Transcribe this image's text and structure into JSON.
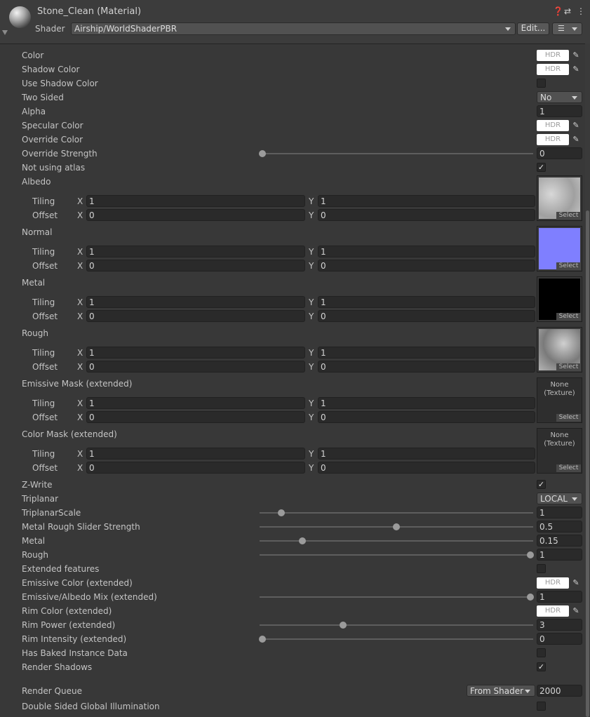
{
  "header": {
    "title": "Stone_Clean (Material)",
    "shader_label": "Shader",
    "shader_value": "Airship/WorldShaderPBR",
    "edit_button": "Edit...",
    "help_icon": "help-icon",
    "preset_icon": "preset-icon",
    "menu_icon": "kebab-menu-icon"
  },
  "common": {
    "hdr": "HDR",
    "x": "X",
    "y": "Y",
    "tiling": "Tiling",
    "offset": "Offset",
    "select": "Select",
    "none1": "None",
    "none2": "(Texture)",
    "check": "✓"
  },
  "colors": {
    "normal_map": "#7f7fff",
    "metal_map": "#000000",
    "background": "#383838"
  },
  "props": {
    "color": "Color",
    "shadow_color": "Shadow Color",
    "use_shadow_color": "Use Shadow Color",
    "two_sided": "Two Sided",
    "two_sided_value": "No",
    "alpha": "Alpha",
    "alpha_value": "1",
    "specular_color": "Specular Color",
    "override_color": "Override Color",
    "override_strength": "Override Strength",
    "override_strength_value": "0",
    "not_using_atlas": "Not using atlas",
    "albedo": "Albedo",
    "normal": "Normal",
    "metal_tex": "Metal",
    "rough_tex": "Rough",
    "emissive_mask": "Emissive Mask (extended)",
    "color_mask": "Color Mask (extended)",
    "tiling_x": "1",
    "tiling_y": "1",
    "offset_x": "0",
    "offset_y": "0",
    "z_write": "Z-Write",
    "triplanar": "Triplanar",
    "triplanar_value": "LOCAL",
    "triplanar_scale": "TriplanarScale",
    "triplanar_scale_value": "1",
    "metal_rough_strength": "Metal Rough Slider Strength",
    "metal_rough_strength_value": "0.5",
    "metal": "Metal",
    "metal_value": "0.15",
    "rough": "Rough",
    "rough_value": "1",
    "extended_features": "Extended features",
    "emissive_color": "Emissive Color (extended)",
    "emissive_albedo_mix": "Emissive/Albedo Mix (extended)",
    "emissive_albedo_mix_value": "1",
    "rim_color": "Rim Color (extended)",
    "rim_power": "Rim Power (extended)",
    "rim_power_value": "3",
    "rim_intensity": "Rim Intensity (extended)",
    "rim_intensity_value": "0",
    "has_baked": "Has Baked Instance Data",
    "render_shadows": "Render Shadows",
    "render_queue": "Render Queue",
    "render_queue_mode": "From Shader",
    "render_queue_value": "2000",
    "double_sided_gi": "Double Sided Global Illumination"
  },
  "sliders": {
    "override_strength": 0,
    "triplanar_scale": 0.07,
    "metal_rough_strength": 0.5,
    "metal": 0.15,
    "rough": 1,
    "emissive_albedo_mix": 1,
    "rim_power": 0.3,
    "rim_intensity": 0
  }
}
